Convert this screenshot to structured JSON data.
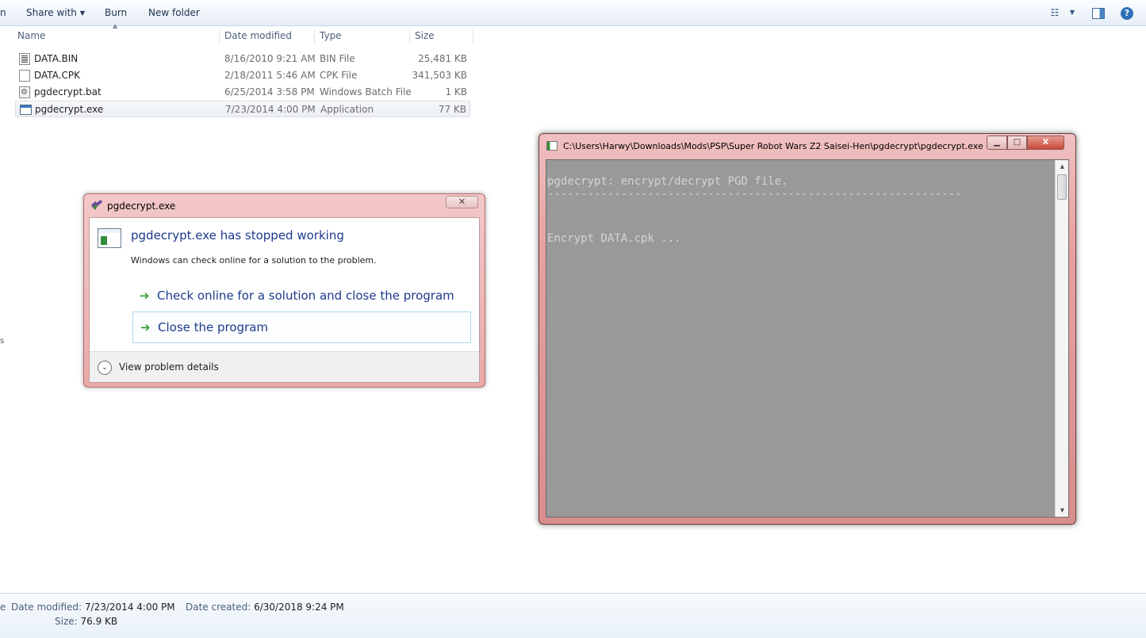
{
  "toolbar": {
    "cut_text": "n",
    "share_with": "Share with",
    "burn": "Burn",
    "new_folder": "New folder",
    "views_icon": "views-icon",
    "preview_pane_icon": "preview-pane-icon",
    "help_icon": "help-icon"
  },
  "columns": {
    "name": "Name",
    "date_modified": "Date modified",
    "type": "Type",
    "size": "Size"
  },
  "files": [
    {
      "name": "DATA.BIN",
      "date": "8/16/2010 9:21 AM",
      "type": "BIN File",
      "size": "25,481 KB",
      "icon": "bin-file-icon"
    },
    {
      "name": "DATA.CPK",
      "date": "2/18/2011 5:46 AM",
      "type": "CPK File",
      "size": "341,503 KB",
      "icon": "blank-file-icon"
    },
    {
      "name": "pgdecrypt.bat",
      "date": "6/25/2014 3:58 PM",
      "type": "Windows Batch File",
      "size": "1 KB",
      "icon": "batch-file-icon"
    },
    {
      "name": "pgdecrypt.exe",
      "date": "7/23/2014 4:00 PM",
      "type": "Application",
      "size": "77 KB",
      "icon": "application-icon",
      "selected": true
    }
  ],
  "left_edge_text": "s",
  "error_dialog": {
    "title": "pgdecrypt.exe",
    "close_symbol": "✕",
    "heading": "pgdecrypt.exe has stopped working",
    "subtext": "Windows can check online for a solution to the problem.",
    "option_check_online": "Check online for a solution and close the program",
    "option_close": "Close the program",
    "arrow_symbol": "➔",
    "view_details": "View problem details",
    "chevron_symbol": "⌄"
  },
  "console": {
    "title": "C:\\Users\\Harwy\\Downloads\\Mods\\PSP\\Super Robot Wars Z2 Saisei-Hen\\pgdecrypt\\pgdecrypt.exe",
    "min_symbol": "▁",
    "max_symbol": "□",
    "close_symbol": "X",
    "lines": [
      "pgdecrypt: encrypt/decrypt PGD file.",
      "--------------------------------------------------------------",
      "Encrypt DATA.cpk ..."
    ],
    "background_color": "#999999",
    "text_color": "#d4d4d4"
  },
  "details_pane": {
    "edge_text": "e",
    "date_modified_label": "Date modified:",
    "date_modified_value": "7/23/2014 4:00 PM",
    "date_created_label": "Date created:",
    "date_created_value": "6/30/2018 9:24 PM",
    "size_label": "Size:",
    "size_value": "76.9 KB"
  }
}
